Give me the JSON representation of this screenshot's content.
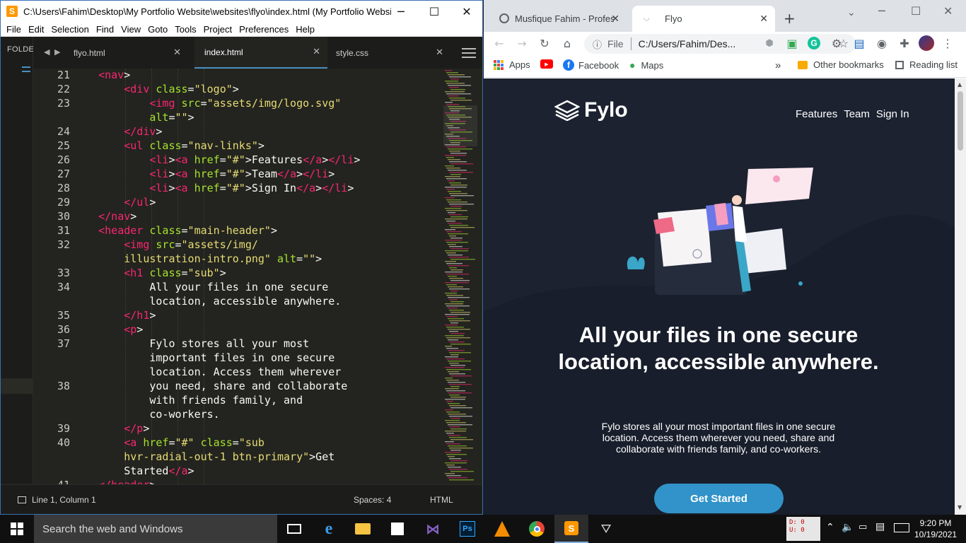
{
  "sublime": {
    "title": "C:\\Users\\Fahim\\Desktop\\My Portfolio Website\\websites\\flyo\\index.html (My Portfolio Website,...",
    "menu": [
      "File",
      "Edit",
      "Selection",
      "Find",
      "View",
      "Goto",
      "Tools",
      "Project",
      "Preferences",
      "Help"
    ],
    "sidebar_label": "FOLDER",
    "tabs": [
      {
        "label": "flyo.html"
      },
      {
        "label": "index.html"
      },
      {
        "label": "style.css"
      }
    ],
    "code_lines": [
      {
        "n": "21",
        "indent": 4,
        "parts": [
          [
            "tg",
            "<nav"
          ],
          [
            "",
            "> "
          ]
        ]
      },
      {
        "n": "22",
        "indent": 8,
        "parts": [
          [
            "tg",
            "<div"
          ],
          [
            "",
            " "
          ],
          [
            "at",
            "class"
          ],
          [
            "",
            "="
          ],
          [
            "st",
            "\"logo\""
          ],
          [
            "",
            ">"
          ]
        ]
      },
      {
        "n": "23",
        "indent": 12,
        "parts": [
          [
            "tg",
            "<img"
          ],
          [
            "",
            " "
          ],
          [
            "at",
            "src"
          ],
          [
            "",
            "="
          ],
          [
            "st",
            "\"assets/img/logo.svg\""
          ]
        ]
      },
      {
        "n": "",
        "indent": 12,
        "parts": [
          [
            "at",
            "alt"
          ],
          [
            "",
            "="
          ],
          [
            "st",
            "\"\""
          ],
          [
            "",
            ">"
          ]
        ]
      },
      {
        "n": "24",
        "indent": 8,
        "parts": [
          [
            "tg",
            "</div"
          ],
          [
            "",
            ">"
          ]
        ]
      },
      {
        "n": "25",
        "indent": 8,
        "parts": [
          [
            "tg",
            "<ul"
          ],
          [
            "",
            " "
          ],
          [
            "at",
            "class"
          ],
          [
            "",
            "="
          ],
          [
            "st",
            "\"nav-links\""
          ],
          [
            "",
            ">"
          ]
        ]
      },
      {
        "n": "26",
        "indent": 12,
        "parts": [
          [
            "tg",
            "<li"
          ],
          [
            "",
            ">"
          ],
          [
            "tg",
            "<a"
          ],
          [
            "",
            " "
          ],
          [
            "at",
            "href"
          ],
          [
            "",
            "="
          ],
          [
            "st",
            "\"#\""
          ],
          [
            "",
            ">Features"
          ],
          [
            "tg",
            "</a"
          ],
          [
            "",
            ">"
          ],
          [
            "tg",
            "</li"
          ],
          [
            "",
            ">"
          ]
        ]
      },
      {
        "n": "27",
        "indent": 12,
        "parts": [
          [
            "tg",
            "<li"
          ],
          [
            "",
            ">"
          ],
          [
            "tg",
            "<a"
          ],
          [
            "",
            " "
          ],
          [
            "at",
            "href"
          ],
          [
            "",
            "="
          ],
          [
            "st",
            "\"#\""
          ],
          [
            "",
            ">Team"
          ],
          [
            "tg",
            "</a"
          ],
          [
            "",
            ">"
          ],
          [
            "tg",
            "</li"
          ],
          [
            "",
            ">"
          ]
        ]
      },
      {
        "n": "28",
        "indent": 12,
        "parts": [
          [
            "tg",
            "<li"
          ],
          [
            "",
            ">"
          ],
          [
            "tg",
            "<a"
          ],
          [
            "",
            " "
          ],
          [
            "at",
            "href"
          ],
          [
            "",
            "="
          ],
          [
            "st",
            "\"#\""
          ],
          [
            "",
            ">Sign In"
          ],
          [
            "tg",
            "</a"
          ],
          [
            "",
            ">"
          ],
          [
            "tg",
            "</li"
          ],
          [
            "",
            ">"
          ]
        ]
      },
      {
        "n": "29",
        "indent": 8,
        "parts": [
          [
            "tg",
            "</ul"
          ],
          [
            "",
            ">"
          ]
        ]
      },
      {
        "n": "30",
        "indent": 4,
        "parts": [
          [
            "tg",
            "</nav"
          ],
          [
            "",
            ">"
          ]
        ]
      },
      {
        "n": "31",
        "indent": 4,
        "parts": [
          [
            "tg",
            "<header"
          ],
          [
            "",
            " "
          ],
          [
            "at",
            "class"
          ],
          [
            "",
            "="
          ],
          [
            "st",
            "\"main-header\""
          ],
          [
            "",
            ">"
          ]
        ]
      },
      {
        "n": "32",
        "indent": 8,
        "parts": [
          [
            "tg",
            "<img"
          ],
          [
            "",
            " "
          ],
          [
            "at",
            "src"
          ],
          [
            "",
            "="
          ],
          [
            "st",
            "\"assets/img/"
          ]
        ]
      },
      {
        "n": "",
        "indent": 8,
        "parts": [
          [
            "st",
            "illustration-intro.png\""
          ],
          [
            "",
            " "
          ],
          [
            "at",
            "alt"
          ],
          [
            "",
            "="
          ],
          [
            "st",
            "\"\""
          ],
          [
            "",
            ">"
          ]
        ]
      },
      {
        "n": "33",
        "indent": 8,
        "parts": [
          [
            "tg",
            "<h1"
          ],
          [
            "",
            " "
          ],
          [
            "at",
            "class"
          ],
          [
            "",
            "="
          ],
          [
            "st",
            "\"sub\""
          ],
          [
            "",
            ">"
          ]
        ]
      },
      {
        "n": "34",
        "indent": 12,
        "parts": [
          [
            "",
            "All your files in one secure"
          ]
        ]
      },
      {
        "n": "",
        "indent": 12,
        "parts": [
          [
            "",
            "location, accessible anywhere."
          ]
        ]
      },
      {
        "n": "35",
        "indent": 8,
        "parts": [
          [
            "tg",
            "</h1"
          ],
          [
            "",
            ">"
          ]
        ]
      },
      {
        "n": "36",
        "indent": 8,
        "parts": [
          [
            "tg",
            "<p"
          ],
          [
            "",
            ">"
          ]
        ]
      },
      {
        "n": "37",
        "indent": 12,
        "parts": [
          [
            "",
            "Fylo stores all your most"
          ]
        ]
      },
      {
        "n": "",
        "indent": 12,
        "parts": [
          [
            "",
            "important files in one secure"
          ]
        ]
      },
      {
        "n": "",
        "indent": 12,
        "parts": [
          [
            "",
            "location. Access them wherever"
          ]
        ]
      },
      {
        "n": "38",
        "indent": 12,
        "parts": [
          [
            "",
            "you need, share and collaborate"
          ]
        ]
      },
      {
        "n": "",
        "indent": 12,
        "parts": [
          [
            "",
            "with friends family, and"
          ]
        ]
      },
      {
        "n": "",
        "indent": 12,
        "parts": [
          [
            "",
            "co-workers."
          ]
        ]
      },
      {
        "n": "39",
        "indent": 8,
        "parts": [
          [
            "tg",
            "</p"
          ],
          [
            "",
            ">"
          ]
        ]
      },
      {
        "n": "40",
        "indent": 8,
        "parts": [
          [
            "tg",
            "<a"
          ],
          [
            "",
            " "
          ],
          [
            "at",
            "href"
          ],
          [
            "",
            "="
          ],
          [
            "st",
            "\"#\""
          ],
          [
            "",
            " "
          ],
          [
            "at",
            "class"
          ],
          [
            "",
            "="
          ],
          [
            "st",
            "\"sub"
          ]
        ]
      },
      {
        "n": "",
        "indent": 8,
        "parts": [
          [
            "st",
            "hvr-radial-out-1 btn-primary\""
          ],
          [
            "",
            ">Get"
          ]
        ]
      },
      {
        "n": "",
        "indent": 8,
        "parts": [
          [
            "",
            "Started"
          ],
          [
            "tg",
            "</a"
          ],
          [
            "",
            ">"
          ]
        ]
      },
      {
        "n": "41",
        "indent": 4,
        "parts": [
          [
            "tg",
            "</header"
          ],
          [
            "",
            ">"
          ]
        ]
      }
    ],
    "status": {
      "position": "Line 1, Column 1",
      "spaces": "Spaces: 4",
      "syntax": "HTML"
    }
  },
  "chrome": {
    "tabs": [
      {
        "label": "Musfique Fahim - Professi"
      },
      {
        "label": "Flyo"
      }
    ],
    "url_scheme": "File",
    "url": "C:/Users/Fahim/Des...",
    "bookmarks": {
      "apps": "Apps",
      "facebook": "Facebook",
      "maps": "Maps",
      "overflow": "»",
      "other": "Other bookmarks",
      "reading": "Reading list"
    }
  },
  "fylo": {
    "brand": "Fylo",
    "nav": [
      "Features",
      "Team",
      "Sign In"
    ],
    "hero_title": "All your files in one secure location, accessible anywhere.",
    "hero_text": "Fylo stores all your most important files in one secure location. Access them wherever you need, share and collaborate with friends family, and co-workers.",
    "cta": "Get Started",
    "colors": {
      "background": "#1c2230",
      "button": "#3193c9"
    }
  },
  "taskbar": {
    "search_placeholder": "Search the web and Windows",
    "net_down": "D: 0",
    "net_up": "U: 0",
    "time": "9:20 PM",
    "date": "10/19/2021"
  }
}
